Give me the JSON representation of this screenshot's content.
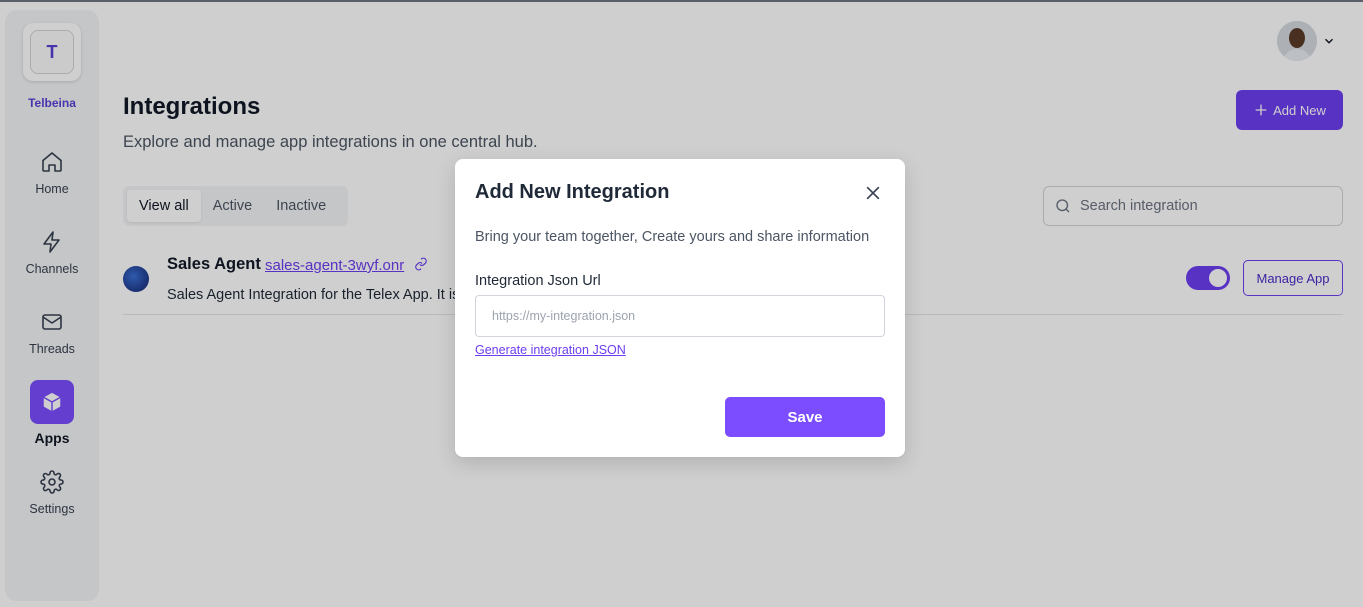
{
  "sidebar": {
    "workspace_initial": "T",
    "workspace_name": "Telbeina",
    "items": [
      {
        "label": "Home",
        "icon": "home-icon"
      },
      {
        "label": "Channels",
        "icon": "lightning-icon"
      },
      {
        "label": "Threads",
        "icon": "mail-icon"
      },
      {
        "label": "Apps",
        "icon": "cube-icon",
        "active": true
      },
      {
        "label": "Settings",
        "icon": "gear-icon"
      }
    ]
  },
  "header": {
    "title": "Integrations",
    "subtitle": "Explore and manage app integrations in one central hub.",
    "add_new_label": "Add New"
  },
  "tabs": [
    "View all",
    "Active",
    "Inactive"
  ],
  "search": {
    "placeholder": "Search integration"
  },
  "integration": {
    "name": "Sales Agent",
    "link": "sales-agent-3wyf.onr",
    "description": "Sales Agent Integration for the Telex App. It is",
    "enabled": true,
    "manage_label": "Manage App"
  },
  "modal": {
    "title": "Add New Integration",
    "description": "Bring your team together, Create yours and share information",
    "field_label": "Integration Json Url",
    "field_placeholder": "https://my-integration.json",
    "generate_link": "Generate integration JSON",
    "save_label": "Save"
  },
  "colors": {
    "accent": "#6d3ef0",
    "accent_light": "#7c4dff",
    "overlay": "rgba(0,0,0,0.19)"
  }
}
